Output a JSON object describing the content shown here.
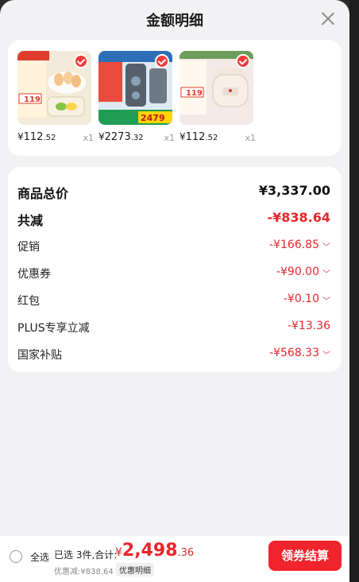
{
  "header": {
    "title": "金额明细"
  },
  "products": [
    {
      "image_label": "Midea egg steamer",
      "yen": "¥",
      "price_int": "112",
      "price_dec": ".52",
      "qty": "x1",
      "accent": "#f6e7c8"
    },
    {
      "image_label": "Midea water purifier",
      "yen": "¥",
      "price_int": "2273",
      "price_dec": ".32",
      "qty": "x1",
      "accent": "#d9e6f1"
    },
    {
      "image_label": "WAHIN rice cooker",
      "yen": "¥",
      "price_int": "112",
      "price_dec": ".52",
      "qty": "x1",
      "accent": "#f7e4e4"
    }
  ],
  "details": {
    "total_label": "商品总价",
    "total_value": "¥3,337.00",
    "reduce_label": "共减",
    "reduce_value": "-¥838.64",
    "promo_label": "促销",
    "promo_value": "-¥166.85",
    "coupon_label": "优惠券",
    "coupon_value": "-¥90.00",
    "redpacket_label": "红包",
    "redpacket_value": "-¥0.10",
    "plus_label": "PLUS专享立减",
    "plus_value": "-¥13.36",
    "subsidy_label": "国家补贴",
    "subsidy_value": "-¥568.33"
  },
  "footer": {
    "select_all": "全选",
    "selected_summary": "已选 3件,合计:",
    "grand_yen": "¥",
    "grand_int": "2,498",
    "grand_dec": ".36",
    "discount_line": "优惠减:¥838.64",
    "detail_tag": "优惠明细",
    "checkout_label": "领券结算"
  },
  "colors": {
    "accent_red": "#e8262b",
    "button_red": "#f0242d"
  }
}
